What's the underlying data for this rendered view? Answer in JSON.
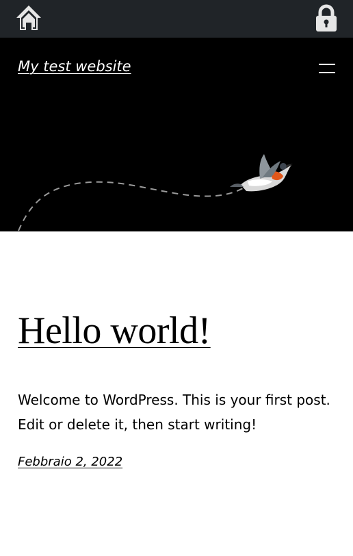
{
  "topbar": {
    "left_icon": "home-icon",
    "right_icon": "lock-icon",
    "background": "#202428"
  },
  "header": {
    "site_title": "My test website",
    "menu_icon": "hamburger-menu-icon",
    "background": "#000000",
    "illustration": "bird-with-dashed-flight-path"
  },
  "post": {
    "title": "Hello world!",
    "content": "Welcome to WordPress. This is your first post. Edit or delete it, then start writing!",
    "date": "Febbraio 2, 2022"
  }
}
